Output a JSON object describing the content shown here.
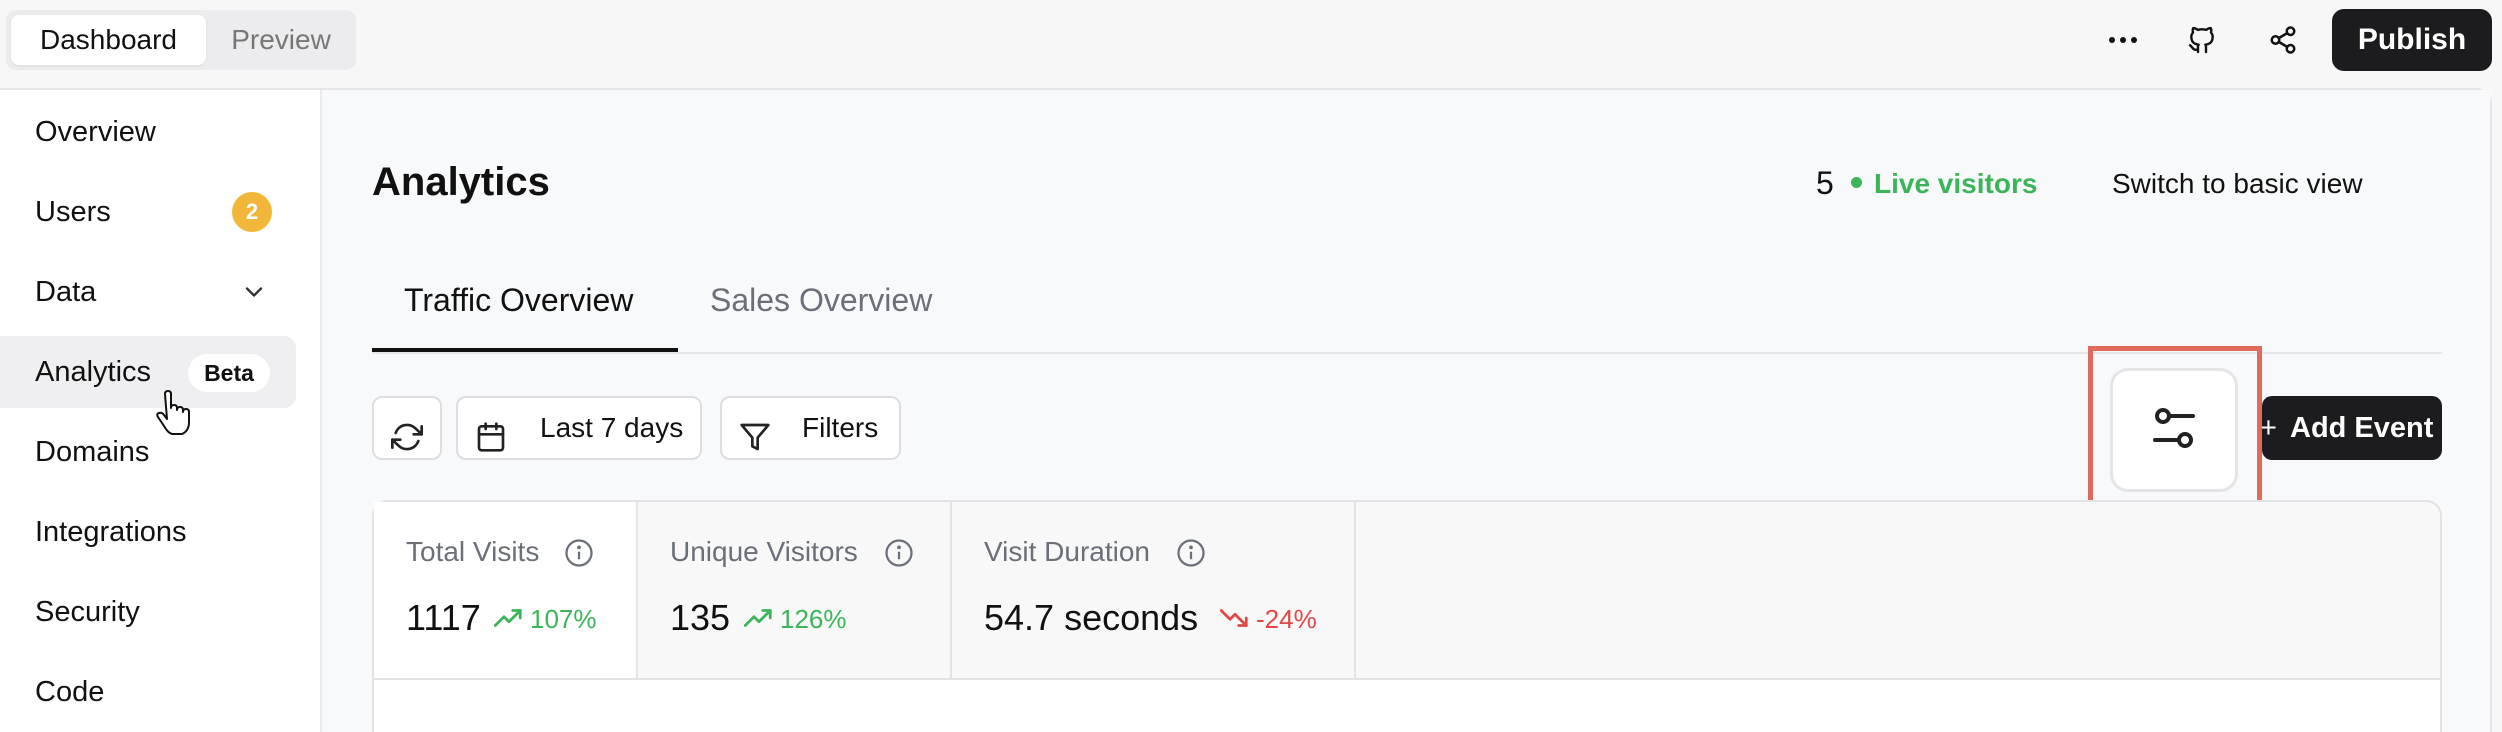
{
  "topbar": {
    "mode_tabs": [
      {
        "label": "Dashboard",
        "active": true
      },
      {
        "label": "Preview",
        "active": false
      }
    ],
    "icons": [
      "more-horizontal-icon",
      "github-icon",
      "share-icon"
    ],
    "publish_label": "Publish"
  },
  "sidebar": {
    "items": [
      {
        "label": "Overview"
      },
      {
        "label": "Users",
        "badge": "2"
      },
      {
        "label": "Data",
        "expandable": true
      },
      {
        "label": "Analytics",
        "badge": "Beta",
        "active": true
      },
      {
        "label": "Domains"
      },
      {
        "label": "Integrations"
      },
      {
        "label": "Security"
      },
      {
        "label": "Code"
      }
    ]
  },
  "header": {
    "title": "Analytics",
    "live_count": "5",
    "live_label": "Live visitors",
    "switch_view_label": "Switch to basic view"
  },
  "tabs": [
    {
      "label": "Traffic Overview",
      "active": true
    },
    {
      "label": "Sales Overview",
      "active": false
    }
  ],
  "toolbar": {
    "date_range_label": "Last 7 days",
    "filters_label": "Filters",
    "add_event_label": "Add Event"
  },
  "stats": [
    {
      "label": "Total Visits",
      "value": "1117",
      "trend": "107%",
      "direction": "up"
    },
    {
      "label": "Unique Visitors",
      "value": "135",
      "trend": "126%",
      "direction": "up"
    },
    {
      "label": "Visit Duration",
      "value": "54.7 seconds",
      "trend": "-24%",
      "direction": "down"
    }
  ],
  "colors": {
    "accent_green": "#3cb55a",
    "accent_red": "#e04848",
    "badge_orange": "#f2b63a",
    "highlight": "#e06a5b",
    "dark_button": "#1c1c1e"
  }
}
